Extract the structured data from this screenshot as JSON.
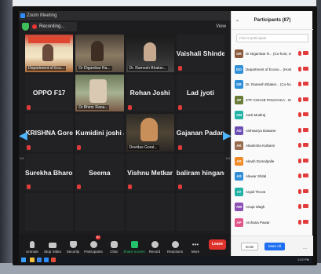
{
  "window": {
    "title": "Zoom Meeting"
  },
  "recording": {
    "label": "Recording..."
  },
  "view_button": {
    "label": "View"
  },
  "tiles": [
    {
      "kind": "video-a",
      "caption": "Department of Eco..."
    },
    {
      "kind": "video-b",
      "caption": "Dr Digambar Ra..."
    },
    {
      "kind": "video-c",
      "caption": "Dr. Ramesh Bhaker..."
    },
    {
      "kind": "name",
      "name": "Vaishali Shinde"
    },
    {
      "kind": "name",
      "name": "OPPO F17"
    },
    {
      "kind": "video-d",
      "caption": "Dr Bhimr Rana..."
    },
    {
      "kind": "name",
      "name": "Rohan Joshi"
    },
    {
      "kind": "name",
      "name": "Lad jyoti"
    },
    {
      "kind": "name",
      "name": "KRISHNA Gore"
    },
    {
      "kind": "name",
      "name": "Kumidini joshi J..."
    },
    {
      "kind": "video-e",
      "caption": "Devidas Gorat..."
    },
    {
      "kind": "name",
      "name": "Gajanan Padam..."
    },
    {
      "kind": "name",
      "name": "Surekha Bharose"
    },
    {
      "kind": "name",
      "name": "Seema"
    },
    {
      "kind": "name",
      "name": "Vishnu Metkar"
    },
    {
      "kind": "name",
      "name": "baliram hingane"
    }
  ],
  "pages": {
    "left": "1/4",
    "right": "1/4"
  },
  "toolbar": {
    "unmute": "Unmute",
    "stop_video": "Stop Video",
    "security": "Security",
    "participants": "Participants",
    "participants_count": "87",
    "chat": "Chat",
    "share_screen": "Share Screen",
    "record": "Record",
    "reactions": "Reactions",
    "more": "More",
    "leave": "Leave"
  },
  "panel": {
    "title": "Participants (87)",
    "search_placeholder": "Find a participant",
    "participants": [
      {
        "initials": "DR",
        "name": "Dr Digambar R... (Co-host, me)",
        "color": "#8a5a3c"
      },
      {
        "initials": "DO",
        "name": "Department of Econo... (Host)",
        "color": "#2f8fd8"
      },
      {
        "initials": "DR",
        "name": "Dr. Ramesh Bhaker... (Co-host)",
        "color": "#2f8fd8"
      },
      {
        "initials": "ZP",
        "name": "ZTF-CHHAB PANAYAKA - GOLF",
        "color": "#6b7d3a"
      },
      {
        "initials": "AM",
        "name": "Aarti Mudiraj",
        "color": "#23b3a6"
      },
      {
        "initials": "AD",
        "name": "Aishwarya Dawane",
        "color": "#6c4fb5"
      },
      {
        "initials": "AK",
        "name": "Akanksha Kulkarni",
        "color": "#9a6c4f"
      },
      {
        "initials": "AD",
        "name": "Akash Domalpalle",
        "color": "#f08a24"
      },
      {
        "initials": "AS",
        "name": "Alewar Shital",
        "color": "#2f8fd8"
      },
      {
        "initials": "AT",
        "name": "Anjali Thorat",
        "color": "#23b3a6"
      },
      {
        "initials": "AW",
        "name": "Anuja Wagh",
        "color": "#8c4fb5"
      },
      {
        "initials": "AP",
        "name": "Archana Pawar",
        "color": "#e0558a"
      }
    ],
    "invite": "Invite",
    "mute_all": "Mute All",
    "more": "..."
  },
  "taskbar": {
    "time": "1:02 PM"
  },
  "colors": {
    "accent": "#2d8cff",
    "mute_red": "#e23b3b",
    "share_green": "#23c16b",
    "leave_red": "#e0322c"
  }
}
